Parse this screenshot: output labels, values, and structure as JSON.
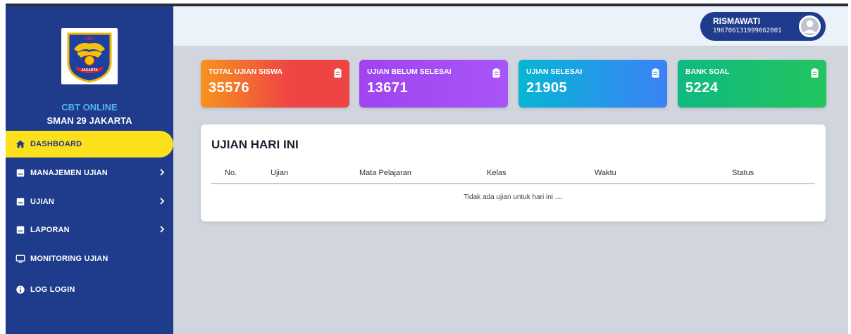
{
  "sidebar": {
    "brand_title": "CBT ONLINE",
    "brand_sub": "SMAN 29 JAKARTA",
    "logo_text": [
      "SMA",
      "JAKARTA"
    ],
    "items": [
      {
        "label": "DASHBOARD",
        "icon": "home-icon",
        "active": true
      },
      {
        "label": "MANAJEMEN UJIAN",
        "icon": "book-icon",
        "chevron": true
      },
      {
        "label": "UJIAN",
        "icon": "book-icon",
        "chevron": true
      },
      {
        "label": "LAPORAN",
        "icon": "book-icon",
        "chevron": true
      },
      {
        "label": "MONITORING UJIAN",
        "icon": "monitor-icon"
      },
      {
        "label": "LOG LOGIN",
        "icon": "info-icon"
      }
    ]
  },
  "user": {
    "name": "RISMAWATI",
    "id": "196706131999062001"
  },
  "cards": [
    {
      "label": "TOTAL UJIAN SISWA",
      "value": "35576",
      "icon": "clipboard-icon"
    },
    {
      "label": "UJIAN BELUM SELESAI",
      "value": "13671",
      "icon": "clipboard-icon"
    },
    {
      "label": "UJIAN SELESAI",
      "value": "21905",
      "icon": "clipboard-icon"
    },
    {
      "label": "BANK SOAL",
      "value": "5224",
      "icon": "clipboard-icon"
    }
  ],
  "today": {
    "title": "UJIAN HARI INI",
    "columns": [
      "No.",
      "Ujian",
      "Mata Pelajaran",
      "Kelas",
      "Waktu",
      "Status"
    ],
    "empty_message": "Tidak ada ujian untuk hari ini ...."
  },
  "colors": {
    "sidebar": "#1f3b8c",
    "active_item": "#fce01c",
    "brand_title": "#52b3f0",
    "card_1": [
      "#f7931e",
      "#ef4444"
    ],
    "card_2": [
      "#9f44f0",
      "#a855f7"
    ],
    "card_3": [
      "#06b6d4",
      "#3b82f6"
    ],
    "card_4": [
      "#10b981",
      "#22c55e"
    ]
  }
}
